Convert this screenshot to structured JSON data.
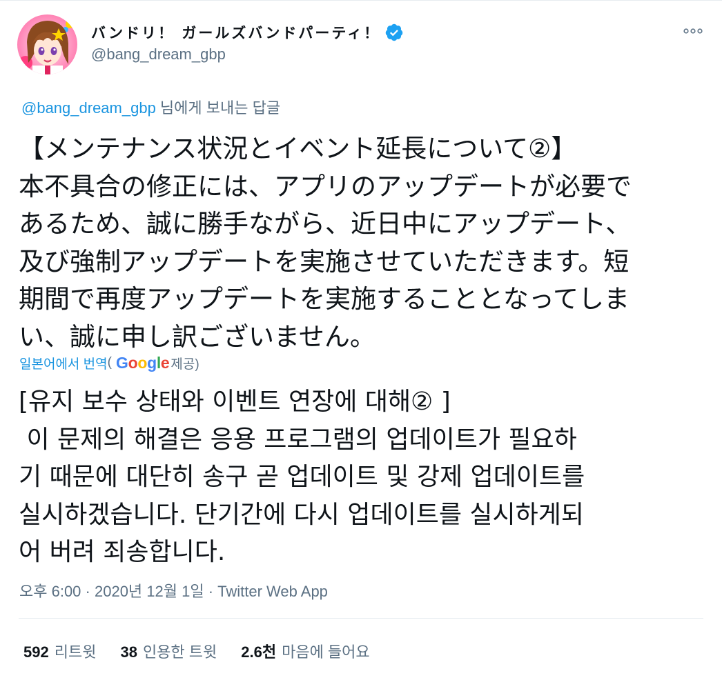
{
  "tweet": {
    "author": {
      "display_name": "バンドリ！ ガールズバンドパーティ！",
      "handle": "@bang_dream_gbp",
      "verified": true
    },
    "reply_context": {
      "mention": "@bang_dream_gbp",
      "suffix": " 님에게 보내는 답글"
    },
    "text_lines": [
      "【メンテナンス状況とイベント延長について②】",
      "本不具合の修正には、アプリのアップデートが必要で",
      "あるため、誠に勝手ながら、近日中にアップデート、",
      "及び強制アップデートを実施させていただきます。短",
      "期間で再度アップデートを実施することとなってしま",
      "い、誠に申し訳ございません。"
    ],
    "translation": {
      "link_label": "일본어에서 번역",
      "paren_open": "(",
      "provider": "Google",
      "provider_suffix": " 제공)"
    },
    "translated_lines": [
      "[유지 보수 상태와 이벤트 연장에 대해② ]",
      " 이 문제의 해결은 응용 프로그램의 업데이트가 필요하",
      "기 때문에 대단히 송구 곧 업데이트 및 강제 업데이트를",
      "실시하겠습니다. 단기간에 다시 업데이트를 실시하게되",
      "어 버려 죄송합니다."
    ],
    "meta": {
      "time": "오후 6:00",
      "separator": " · ",
      "date": "2020년 12월 1일",
      "source": "Twitter Web App"
    },
    "stats": [
      {
        "count": "592",
        "label": "리트윗"
      },
      {
        "count": "38",
        "label": "인용한 트윗"
      },
      {
        "count": "2.6천",
        "label": "마음에 들어요"
      }
    ]
  },
  "colors": {
    "text": "#0f1419",
    "secondary": "#5b7083",
    "link": "#1b95e0",
    "verified": "#1da1f2",
    "divider": "#e6ecf0"
  }
}
